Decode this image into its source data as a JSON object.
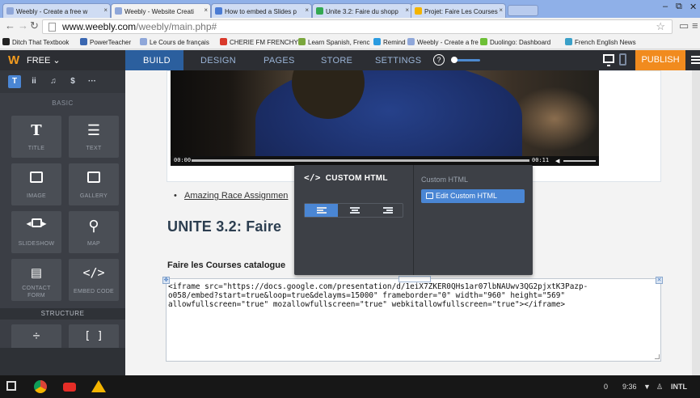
{
  "browser": {
    "tabs": [
      {
        "label": "Weebly - Create a free w",
        "color": "#8fa7d9"
      },
      {
        "label": "Weebly - Website Creati",
        "color": "#8fa7d9"
      },
      {
        "label": "How to embed a Slides p",
        "color": "#4a7bd4"
      },
      {
        "label": "Unite 3.2: Faire du shopp",
        "color": "#33a852"
      },
      {
        "label": "Projet: Faire Les Courses",
        "color": "#f4b400"
      }
    ],
    "url_host": "www.weebly.com",
    "url_path": "/weebly/main.php#",
    "bookmarks": [
      {
        "label": "Ditch That Textbook",
        "color": "#222222"
      },
      {
        "label": "PowerTeacher",
        "color": "#3a67b1"
      },
      {
        "label": "Le Cours de français",
        "color": "#8fa7d9"
      },
      {
        "label": "CHERIE FM FRENCHY",
        "color": "#d9392b"
      },
      {
        "label": "Learn Spanish, Frenc",
        "color": "#7aa63c"
      },
      {
        "label": "Remind",
        "color": "#2a9be0"
      },
      {
        "label": "Weebly - Create a fre",
        "color": "#8fa7d9"
      },
      {
        "label": "Duolingo: Dashboard",
        "color": "#6dbf36"
      },
      {
        "label": "French English News",
        "color": "#3aa0c8"
      }
    ]
  },
  "weebly": {
    "logo": "W",
    "plan": "FREE",
    "nav": [
      "BUILD",
      "DESIGN",
      "PAGES",
      "STORE",
      "SETTINGS"
    ],
    "help": "?",
    "publish": "PUBLISH",
    "accent": "#f18b1e"
  },
  "sidebar": {
    "tabs": [
      "T",
      "ii",
      "♫",
      "$",
      "···"
    ],
    "basic_label": "BASIC",
    "structure_label": "STRUCTURE",
    "elements": [
      {
        "label": "TITLE"
      },
      {
        "label": "TEXT"
      },
      {
        "label": "IMAGE"
      },
      {
        "label": "GALLERY"
      },
      {
        "label": "SLIDESHOW"
      },
      {
        "label": "MAP"
      },
      {
        "label": "CONTACT FORM"
      },
      {
        "label": "EMBED CODE"
      }
    ]
  },
  "content": {
    "video_time_start": "00:00",
    "video_time_end": "00:11",
    "bullet_link": "Amazing Race Assignmen",
    "heading": "UNITE 3.2: Faire",
    "subheading": "Faire les Courses catalogue",
    "embed_code_lines": [
      "<iframe src=\"https://docs.google.com/presentation/d/1eiX7ZKER0QHs1ar07lbNAUwv3QG2pjxtK3Pazp-",
      "o058/embed?start=true&loop=true&delayms=15000\" frameborder=\"0\" width=\"960\" height=\"569\"",
      "allowfullscreen=\"true\" mozallowfullscreen=\"true\" webkitallowfullscreen=\"true\"></iframe>"
    ]
  },
  "popup": {
    "title": "CUSTOM HTML",
    "right_label": "Custom HTML",
    "edit_button": "Edit Custom HTML"
  },
  "taskbar": {
    "notifications": "0",
    "time": "9:36",
    "locale": "INTL"
  }
}
